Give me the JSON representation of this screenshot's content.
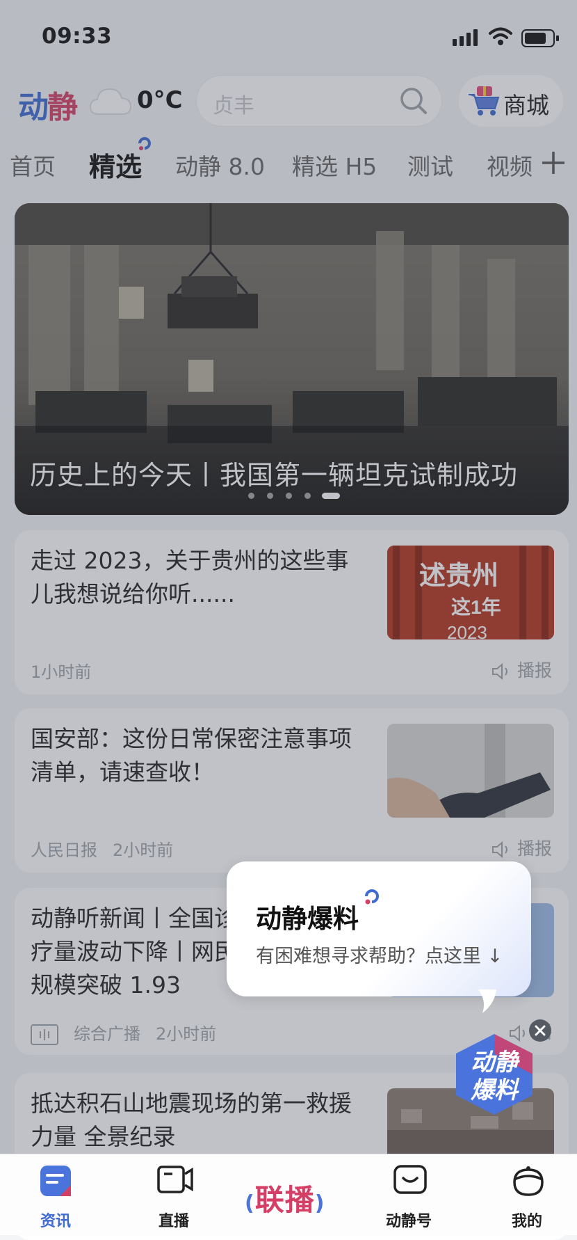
{
  "status_bar": {
    "time": "09:33"
  },
  "header": {
    "logo": [
      "动",
      "静"
    ],
    "temperature": "0°C",
    "search_placeholder": "贞丰",
    "mall_label": "商城"
  },
  "tabs": [
    "首页",
    "精选",
    "动静 8.0",
    "精选 H5",
    "测试",
    "视频"
  ],
  "active_tab": "精选",
  "banner": {
    "title": "历史上的今天丨我国第一辆坦克试制成功",
    "page_count": 5,
    "active_index": 4
  },
  "news": [
    {
      "title": "走过 2023，关于贵州的这些事儿我想说给你听......",
      "source": "",
      "time": "1小时前",
      "broadcast": "播报",
      "thumb_text": [
        "述贵州",
        "这1年",
        "2023"
      ]
    },
    {
      "title": "国安部：这份日常保密注意事项清单，请速查收！",
      "source": "人民日报",
      "time": "2小时前",
      "broadcast": "播报"
    },
    {
      "title": "动静听新闻丨全国诊疗量波动下降丨网民规模突破 1.93",
      "source": "综合广播",
      "time": "2小时前",
      "broadcast": "播"
    },
    {
      "title": "抵达积石山地震现场的第一救援力量 全景纪录"
    }
  ],
  "popup": {
    "title": "动静爆料",
    "subtitle": "有困难想寻求帮助？点这里 ↓",
    "badge_text": [
      "动静",
      "爆料"
    ]
  },
  "bottom_nav": {
    "items": [
      "资讯",
      "直播",
      "动静号",
      "我的"
    ],
    "center_label": "联播",
    "active": "资讯"
  },
  "colors": {
    "brand_blue": "#3f6bd3",
    "brand_red": "#d53f66"
  }
}
